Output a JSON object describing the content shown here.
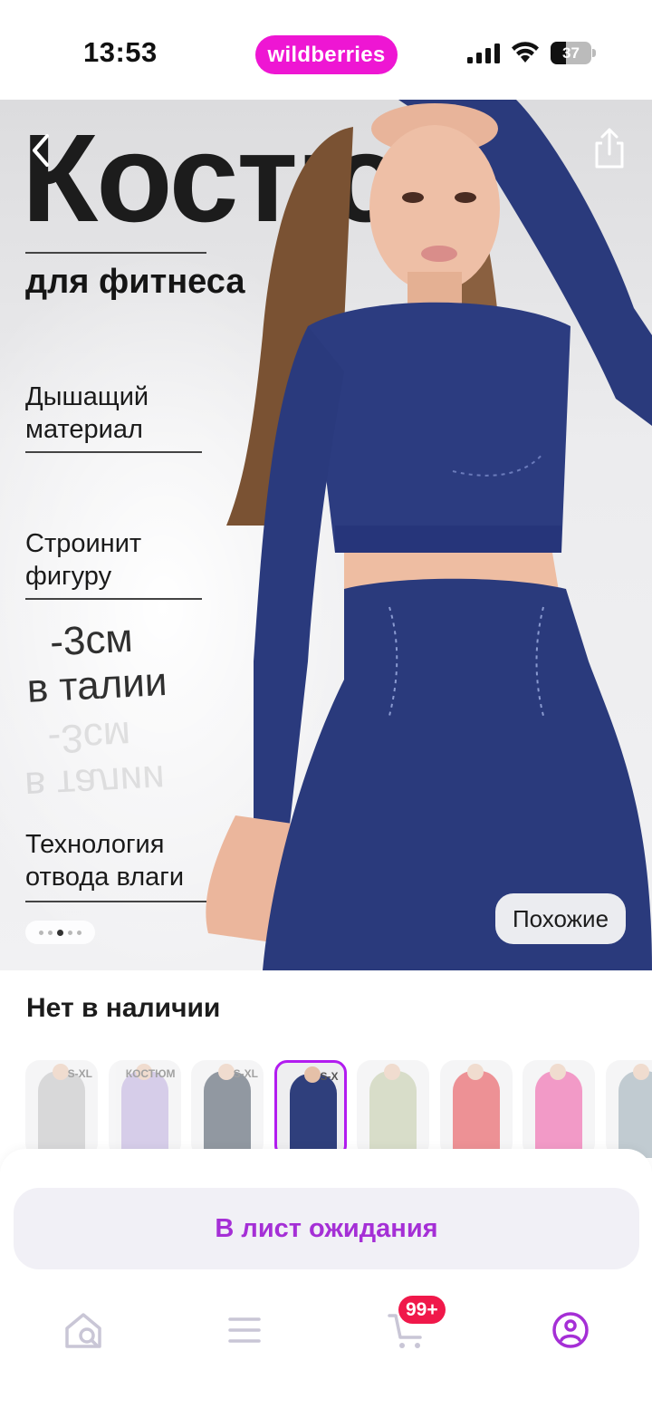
{
  "status_bar": {
    "time": "13:53",
    "brand": "wildberries",
    "battery": "37",
    "battery_level": 0.37
  },
  "hero": {
    "title": "Костюм",
    "subtitle": "для фитнеса",
    "features": [
      "Дышащий\nматериал",
      "Строинит\nфигуру",
      "Технология\nотвода влаги"
    ],
    "promo_line1": "-3см",
    "promo_line2": "в талии",
    "similar_button": "Похожие",
    "pager": {
      "count": 5,
      "active": 2
    }
  },
  "availability": "Нет в наличии",
  "variants": [
    {
      "color": "#b9b9bb",
      "size_tag": "S-XL",
      "selected": false
    },
    {
      "color": "#b6a6d8",
      "size_tag": "КОСТЮМ",
      "selected": false
    },
    {
      "color": "#394456",
      "size_tag": "S-XL",
      "selected": false
    },
    {
      "color": "#2f3f7c",
      "size_tag": "S-X",
      "selected": true
    },
    {
      "color": "#b9c39e",
      "size_tag": "",
      "selected": false
    },
    {
      "color": "#e0383f",
      "size_tag": "",
      "selected": false
    },
    {
      "color": "#e8489a",
      "size_tag": "",
      "selected": false
    },
    {
      "color": "#8fa2ad",
      "size_tag": "",
      "selected": false
    }
  ],
  "actions": {
    "waitlist_button": "В лист ожидания"
  },
  "tabbar": {
    "items": [
      "home-search-icon",
      "menu-icon",
      "cart-icon",
      "profile-icon"
    ],
    "cart_badge": "99+",
    "active_color": "#a52fd6",
    "inactive_color": "#c9c6d6"
  },
  "colors": {
    "brand": "#ee16d3",
    "accent": "#a52fd6",
    "badge": "#f0184a",
    "suit": "#2c3c80"
  }
}
